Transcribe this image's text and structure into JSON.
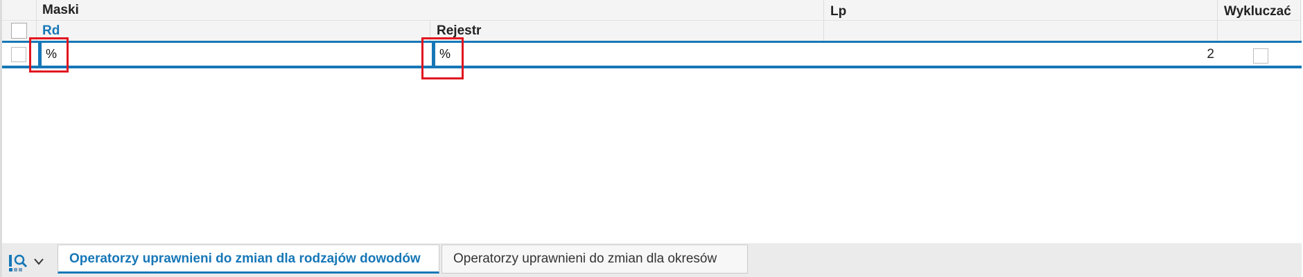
{
  "grid": {
    "group_header": "Maski",
    "columns": {
      "rd": "Rd",
      "rejestr": "Rejestr",
      "lp": "Lp",
      "wykluczac": "Wykluczać"
    },
    "rows": [
      {
        "rd": "%",
        "rejestr": "%",
        "lp": "2",
        "wykluczac": false
      }
    ]
  },
  "tabs": [
    {
      "label": "Operatorzy uprawnieni do zmian dla rodzajów dowodów",
      "active": true
    },
    {
      "label": "Operatorzy uprawnieni do zmian dla okresów",
      "active": false
    }
  ],
  "toolbar": {
    "icon": "search-layout-icon",
    "dropdown_icon": "chevron-down-icon"
  },
  "colors": {
    "accent": "#1677b7",
    "highlight": "#e0141e",
    "header_bg": "#f4f4f4"
  }
}
